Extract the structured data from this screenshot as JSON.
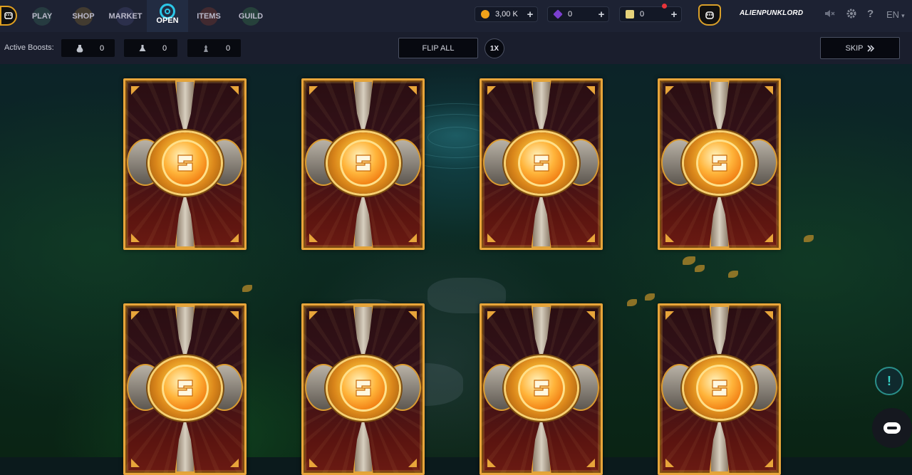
{
  "nav": {
    "items": [
      {
        "key": "play",
        "label": "PLAY"
      },
      {
        "key": "shop",
        "label": "SHOP"
      },
      {
        "key": "market",
        "label": "MARKET"
      },
      {
        "key": "open",
        "label": "OPEN"
      },
      {
        "key": "items",
        "label": "ITEMS"
      },
      {
        "key": "guild",
        "label": "GUILD"
      }
    ],
    "active": "open"
  },
  "resources": {
    "coins": {
      "value": "3,00 K",
      "icon": "gold-coin-icon",
      "color": "#f0a21a"
    },
    "gems": {
      "value": "0",
      "icon": "purple-gem-icon",
      "color": "#7b3fd0"
    },
    "tickets": {
      "value": "0",
      "icon": "ticket-icon",
      "color": "#e6d27a"
    }
  },
  "user": {
    "name": "ALIENPUNKLORD"
  },
  "language": "EN",
  "boosts": {
    "label": "Active Boosts:",
    "slots": [
      {
        "icon": "potion-icon",
        "value": "0"
      },
      {
        "icon": "flask-icon",
        "value": "0"
      },
      {
        "icon": "totem-icon",
        "value": "0"
      }
    ]
  },
  "actions": {
    "flip_all": "FLIP ALL",
    "speed": "1X",
    "skip": "SKIP"
  },
  "cards": {
    "count": 8,
    "state": "face-down"
  },
  "colors": {
    "accent": "#2bc7e8",
    "card_border": "#e8a53a",
    "topbar": "#1d2233"
  }
}
